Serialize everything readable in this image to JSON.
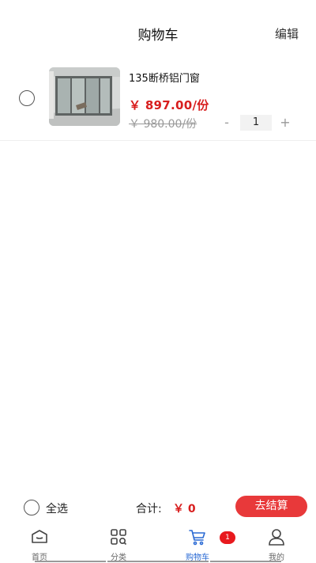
{
  "header": {
    "title": "购物车",
    "edit_label": "编辑"
  },
  "cart_items": [
    {
      "name": "135断桥铝门窗",
      "price": "￥ 897.00/份",
      "original_price": "￥ 980.00/份",
      "quantity": "1",
      "minus_label": "-",
      "plus_label": "+"
    }
  ],
  "footer": {
    "select_all_label": "全选",
    "total_label": "合计:",
    "total_value": "￥ 0",
    "checkout_label": "去结算"
  },
  "tabbar": {
    "items": [
      {
        "label": "首页",
        "icon": "home-icon"
      },
      {
        "label": "分类",
        "icon": "category-icon"
      },
      {
        "label": "购物车",
        "icon": "cart-icon",
        "active": true
      },
      {
        "label": "我的",
        "icon": "user-icon"
      }
    ],
    "cart_badge": "1"
  },
  "colors": {
    "accent_red": "#d81e1e",
    "checkout_button": "#e8393a",
    "active_tab": "#2a6ad4"
  }
}
